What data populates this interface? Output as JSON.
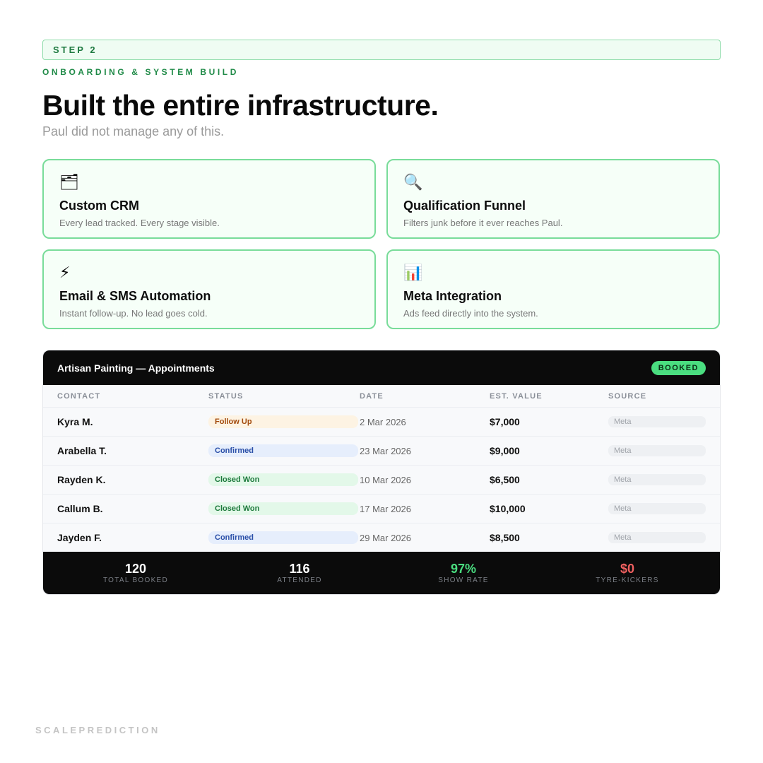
{
  "step": {
    "label": "STEP 2"
  },
  "kicker": "ONBOARDING & SYSTEM BUILD",
  "headline": "Built the entire infrastructure.",
  "subline": "Paul did not manage any of this.",
  "features": [
    {
      "icon": "🗂",
      "icon_name": "card-index-dividers-icon",
      "title": "Custom CRM",
      "desc": "Every lead tracked. Every stage visible."
    },
    {
      "icon": "🔍",
      "icon_name": "magnifying-glass-icon",
      "title": "Qualification Funnel",
      "desc": "Filters junk before it ever reaches Paul."
    },
    {
      "icon": "⚡",
      "icon_name": "lightning-bolt-icon",
      "title": "Email & SMS Automation",
      "desc": "Instant follow-up. No lead goes cold."
    },
    {
      "icon": "📊",
      "icon_name": "bar-chart-icon",
      "title": "Meta Integration",
      "desc": "Ads feed directly into the system."
    }
  ],
  "panel": {
    "title": "Artisan Painting — Appointments",
    "badge": "BOOKED",
    "columns": [
      "CONTACT",
      "STATUS",
      "DATE",
      "EST. VALUE",
      "SOURCE"
    ],
    "rows": [
      {
        "contact": "Kyra M.",
        "status": "Follow Up",
        "date": "2 Mar 2026",
        "value": "$7,000",
        "source": "Meta"
      },
      {
        "contact": "Arabella T.",
        "status": "Confirmed",
        "date": "23 Mar 2026",
        "value": "$9,000",
        "source": "Meta"
      },
      {
        "contact": "Rayden K.",
        "status": "Closed Won",
        "date": "10 Mar 2026",
        "value": "$6,500",
        "source": "Meta"
      },
      {
        "contact": "Callum B.",
        "status": "Closed Won",
        "date": "17 Mar 2026",
        "value": "$10,000",
        "source": "Meta"
      },
      {
        "contact": "Jayden F.",
        "status": "Confirmed",
        "date": "29 Mar 2026",
        "value": "$8,500",
        "source": "Meta"
      }
    ],
    "stats": [
      {
        "value": "120",
        "label": "TOTAL BOOKED"
      },
      {
        "value": "116",
        "label": "ATTENDED"
      },
      {
        "value": "97%",
        "label": "SHOW RATE"
      },
      {
        "value": "$0",
        "label": "TYRE-KICKERS"
      }
    ]
  },
  "brand": "SCALEPREDICTION",
  "colors": {
    "accent_green": "#4ade80",
    "accent_red": "#f06060",
    "card_border": "#79dc9a",
    "dark_panel": "#0b0b0b"
  }
}
